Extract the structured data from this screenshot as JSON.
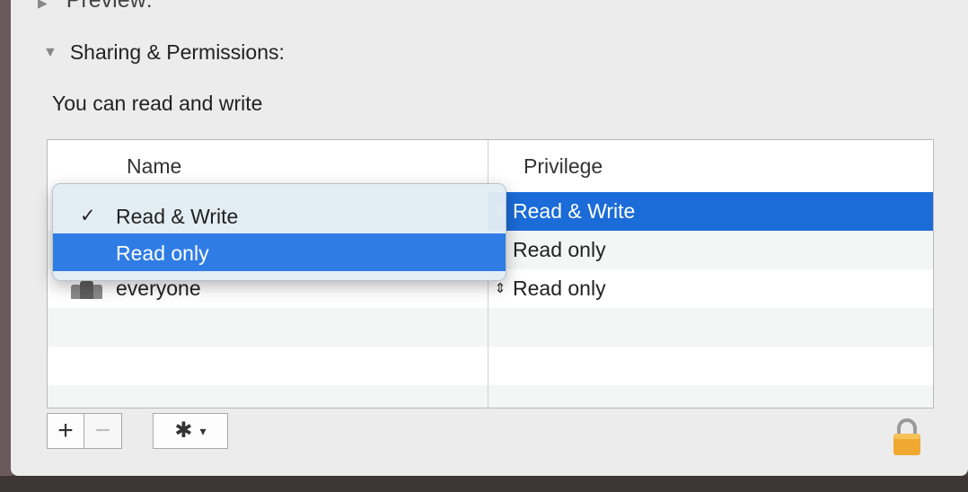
{
  "preview_label": "Preview:",
  "section": {
    "title": "Sharing & Permissions:"
  },
  "status_text": "You can read and write",
  "table": {
    "columns": {
      "name": "Name",
      "privilege": "Privilege"
    },
    "rows": [
      {
        "name": "",
        "privilege": "Read & Write",
        "selected": true
      },
      {
        "name": "",
        "privilege": "Read only"
      },
      {
        "name": "everyone",
        "privilege": "Read only",
        "icon": "group-icon"
      }
    ]
  },
  "popup_menu": {
    "items": [
      {
        "label": "Read & Write",
        "checked": true,
        "check_glyph": "✓"
      },
      {
        "label": "Read only",
        "highlighted": true
      }
    ]
  },
  "toolbar": {
    "add_glyph": "+",
    "remove_glyph": "−",
    "action_icon": "gear-icon",
    "chevron_glyph": "⌄"
  },
  "icons": {
    "stepper": "⇕",
    "disclosure": "▼",
    "lock": "lock-icon"
  },
  "colors": {
    "selection": "#1b6bd8",
    "menu_highlight": "#2f7ce5",
    "lock": "#f0a830"
  }
}
